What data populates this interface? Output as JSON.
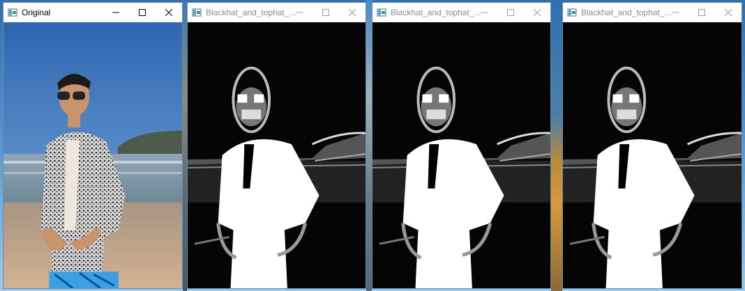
{
  "windows": [
    {
      "title": "Original",
      "state": "active",
      "icon": "opencv-window-icon",
      "content": "original-photo"
    },
    {
      "title": "Blackhat_and_tophat_...",
      "state": "inactive",
      "icon": "opencv-window-icon",
      "content": "processed-image"
    },
    {
      "title": "Blackhat_and_tophat_...",
      "state": "inactive",
      "icon": "opencv-window-icon",
      "content": "processed-image"
    },
    {
      "title": "Blackhat_and_tophat_...",
      "state": "inactive",
      "icon": "opencv-window-icon",
      "content": "processed-image"
    }
  ],
  "controls": {
    "minimize": "minimize-icon",
    "maximize": "maximize-icon",
    "close": "close-icon"
  },
  "colors": {
    "sky": "#3f7fc4",
    "sea": "#6f8fa8",
    "sand": "#c9a98a",
    "processed_bg": "#050505",
    "processed_fg": "#ffffff"
  }
}
